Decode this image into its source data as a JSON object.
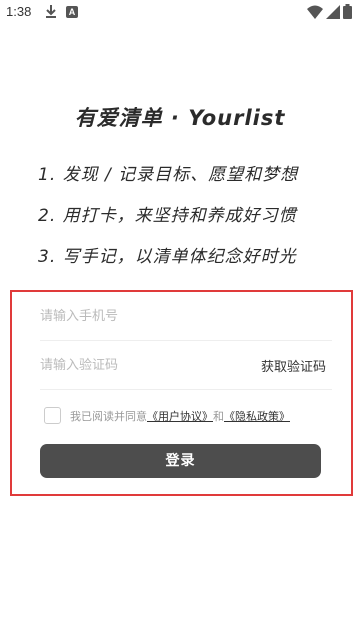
{
  "status_bar": {
    "time": "1:38",
    "icons": [
      "download-icon",
      "a-notification-icon",
      "wifi-icon",
      "signal-icon",
      "battery-icon"
    ]
  },
  "app": {
    "title": "有爱清单 · Yourlist"
  },
  "slogans": [
    "1. 发现 / 记录目标、愿望和梦想",
    "2. 用打卡，来坚持和养成好习惯",
    "3. 写手记，以清单体纪念好时光"
  ],
  "form": {
    "phone_placeholder": "请输入手机号",
    "code_placeholder": "请输入验证码",
    "get_code_label": "获取验证码",
    "agree_prefix": "我已阅读并同意",
    "agreement_link": "《用户协议》",
    "agree_and": "和",
    "privacy_link": "《隐私政策》",
    "login_label": "登录"
  },
  "colors": {
    "highlight_border": "#e03a3a",
    "button_bg": "#4d4d4d"
  }
}
